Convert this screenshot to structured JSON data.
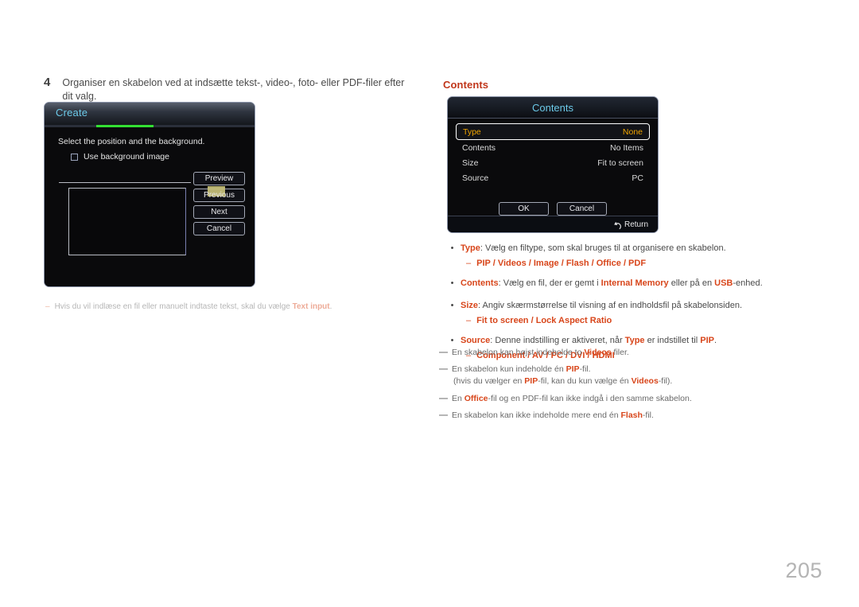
{
  "step": {
    "number": "4",
    "text": "Organiser en skabelon ved at indsætte tekst-, video-, foto- eller PDF-filer efter dit valg."
  },
  "create_dialog": {
    "title": "Create",
    "instruction": "Select the position and the background.",
    "checkbox_label": "Use background image",
    "buttons": [
      "Preview",
      "Previous",
      "Next",
      "Cancel"
    ],
    "progress_percent": 28,
    "accent_green": "#33e033",
    "title_color": "#6cc9e8",
    "highlight_color": "#c7c07a"
  },
  "left_note": {
    "dash": "–",
    "prefix": "Hvis du vil indlæse en fil eller manuelt indtaste tekst, skal du vælge ",
    "bold": "Text input",
    "suffix": "."
  },
  "contents_heading": "Contents",
  "contents_dialog": {
    "title": "Contents",
    "rows": [
      {
        "label": "Type",
        "value": "None",
        "selected": true
      },
      {
        "label": "Contents",
        "value": "No Items",
        "selected": false
      },
      {
        "label": "Size",
        "value": "Fit to screen",
        "selected": false
      },
      {
        "label": "Source",
        "value": "PC",
        "selected": false
      }
    ],
    "buttons": [
      "OK",
      "Cancel"
    ],
    "footer": {
      "icon": "return-arrow-icon",
      "label": "Return"
    },
    "selected_text_color": "#f0a400",
    "title_color": "#6cc9e8"
  },
  "bullets": [
    {
      "lead": "Type",
      "rest": ": Vælg en filtype, som skal bruges til at organisere en skabelon.",
      "sub": "PIP / Videos / Image / Flash / Office / PDF"
    },
    {
      "lead": "Contents",
      "rest_parts": [
        {
          "t": ": Vælg en fil, der er gemt i ",
          "b": false
        },
        {
          "t": "Internal Memory",
          "b": true
        },
        {
          "t": " eller på en ",
          "b": false
        },
        {
          "t": "USB",
          "b": true
        },
        {
          "t": "-enhed.",
          "b": false
        }
      ],
      "sub": null
    },
    {
      "lead": "Size",
      "rest": ": Angiv skærmstørrelse til visning af en indholdsfil på skabelonsiden.",
      "sub": "Fit to screen / Lock Aspect Ratio"
    },
    {
      "lead": "Source",
      "rest_parts": [
        {
          "t": ": Denne indstilling er aktiveret, når ",
          "b": false
        },
        {
          "t": "Type",
          "b": true
        },
        {
          "t": " er indstillet til ",
          "b": false
        },
        {
          "t": "PIP",
          "b": true
        },
        {
          "t": ".",
          "b": false
        }
      ],
      "sub": "Component / AV / PC / DVI / HDMI"
    }
  ],
  "notes": [
    {
      "parts": [
        {
          "t": "En skabelon kan højst indeholde to ",
          "b": false
        },
        {
          "t": "Videos",
          "b": true
        },
        {
          "t": " filer.",
          "b": false
        }
      ],
      "sub_parts": null
    },
    {
      "parts": [
        {
          "t": "En skabelon kun indeholde én ",
          "b": false
        },
        {
          "t": "PIP",
          "b": true
        },
        {
          "t": "-fil.",
          "b": false
        }
      ],
      "sub_parts": [
        {
          "t": "(hvis du vælger en ",
          "b": false
        },
        {
          "t": "PIP",
          "b": true
        },
        {
          "t": "-fil, kan du kun vælge én ",
          "b": false
        },
        {
          "t": "Videos",
          "b": true
        },
        {
          "t": "-fil).",
          "b": false
        }
      ]
    },
    {
      "parts": [
        {
          "t": "En ",
          "b": false
        },
        {
          "t": "Office",
          "b": true
        },
        {
          "t": "-fil og en PDF-fil kan ikke indgå i den samme skabelon.",
          "b": false
        }
      ],
      "sub_parts": null
    },
    {
      "parts": [
        {
          "t": "En skabelon kan ikke indeholde mere end én ",
          "b": false
        },
        {
          "t": "Flash",
          "b": true
        },
        {
          "t": "-fil.",
          "b": false
        }
      ],
      "sub_parts": null
    }
  ],
  "page_number": "205"
}
